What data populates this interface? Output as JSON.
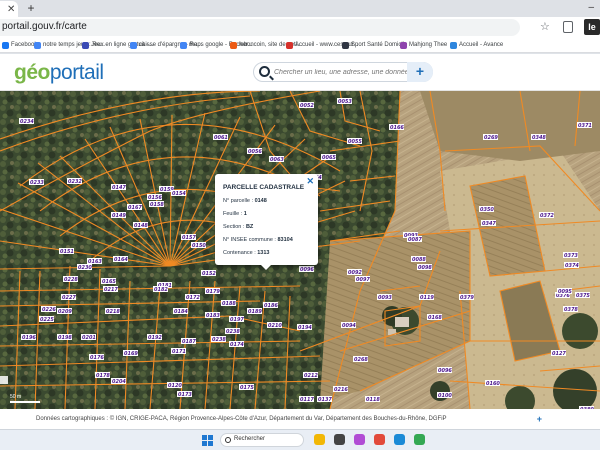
{
  "browser": {
    "tab_close": "✕",
    "new_tab": "+",
    "url": "portail.gouv.fr/carte",
    "profile_label": "le",
    "bookmarks": [
      {
        "label": "Facebook",
        "icon": "facebook-icon",
        "color": "#1877f2"
      },
      {
        "label": "notre temps jeux : Re...",
        "icon": "google-icon",
        "color": "#4285f4"
      },
      {
        "label": "Jeux en ligne gratuit -...",
        "icon": "jeux-icon",
        "color": "#3b4bb5"
      },
      {
        "label": "caisse d'épargne - Re...",
        "icon": "google-icon",
        "color": "#4285f4"
      },
      {
        "label": "maps google - Recher...",
        "icon": "google-icon",
        "color": "#4285f4"
      },
      {
        "label": "leboncoin, site de peti...",
        "icon": "leboncoin-icon",
        "color": "#ec5a13"
      },
      {
        "label": "Accueil - www.cesu.ur...",
        "icon": "cesu-icon",
        "color": "#d6312b"
      },
      {
        "label": "Sport Santé Domicile",
        "icon": "sport-icon",
        "color": "#2f3542"
      },
      {
        "label": "Mahjong Thee",
        "icon": "mahjong-icon",
        "color": "#8e44ad"
      },
      {
        "label": "Accueil - Avance",
        "icon": "avance-icon",
        "color": "#2e86de"
      }
    ]
  },
  "header": {
    "logo_geo": "géo",
    "logo_portail": "portail",
    "search_placeholder": "Chercher un lieu, une adresse, une donnée",
    "search_button": "+"
  },
  "popup": {
    "title": "PARCELLE CADASTRALE",
    "close": "✕",
    "rows": [
      {
        "label": "N° parcelle :",
        "value": "0148"
      },
      {
        "label": "Feuille :",
        "value": "1"
      },
      {
        "label": "Section :",
        "value": "BZ"
      },
      {
        "label": "N° INSEE commune :",
        "value": "83104"
      },
      {
        "label": "Contenance :",
        "value": "1313"
      }
    ]
  },
  "map": {
    "scale_label": "50 m",
    "parcel_labels": [
      "0234",
      "0052",
      "0053",
      "0055",
      "0061",
      "0056",
      "0063",
      "0064",
      "0065",
      "0166",
      "0232",
      "0147",
      "0233",
      "0158",
      "0159",
      "0154",
      "0156",
      "0157",
      "0150",
      "0167",
      "0149",
      "0148",
      "0151",
      "0163",
      "0230",
      "0164",
      "0228",
      "0165",
      "0227",
      "0217",
      "0209",
      "0218",
      "0181",
      "0182",
      "0226",
      "0152",
      "0184",
      "0187",
      "0225",
      "0196",
      "0201",
      "0192",
      "0198",
      "0169",
      "0171",
      "0174",
      "0176",
      "0178",
      "0183",
      "0172",
      "0186",
      "0188",
      "0189",
      "0197",
      "0204",
      "0179",
      "0238",
      "0238",
      "0210",
      "0120",
      "0137",
      "0173",
      "0175",
      "0212",
      "0216",
      "0092",
      "0093",
      "0094",
      "0096",
      "0097",
      "0098",
      "0100",
      "0117",
      "0118",
      "0119",
      "0127",
      "0160",
      "0168",
      "0194",
      "0268",
      "0269",
      "0348",
      "0347",
      "0350",
      "0371",
      "0372",
      "0373",
      "0374",
      "0375",
      "0376",
      "0378",
      "0379",
      "0380",
      "0096",
      "0095",
      "0093",
      "0087",
      "0088",
      "0063"
    ],
    "colors": {
      "parcel_line": "#f08a24",
      "label_text": "#4a148c"
    }
  },
  "attribution": {
    "text": "Données cartographiques : ©    IGN,  CRIGE-PACA,  Région Provence-Alpes-Côte d'Azur,  Département du Var,  Département des Bouches-du-Rhône,  DGFiP",
    "plus": "+"
  },
  "taskbar": {
    "search_text": "Rechercher",
    "apps": [
      {
        "icon": "file-explorer-icon",
        "color": "#f2b705"
      },
      {
        "icon": "taskview-icon",
        "color": "#444444"
      },
      {
        "icon": "copilot-icon",
        "color": "#b14cd4"
      },
      {
        "icon": "store-icon",
        "color": "#e24a3b"
      },
      {
        "icon": "edge-icon",
        "color": "#1b8ad6"
      },
      {
        "icon": "chrome-icon",
        "color": "#34a853"
      }
    ]
  }
}
